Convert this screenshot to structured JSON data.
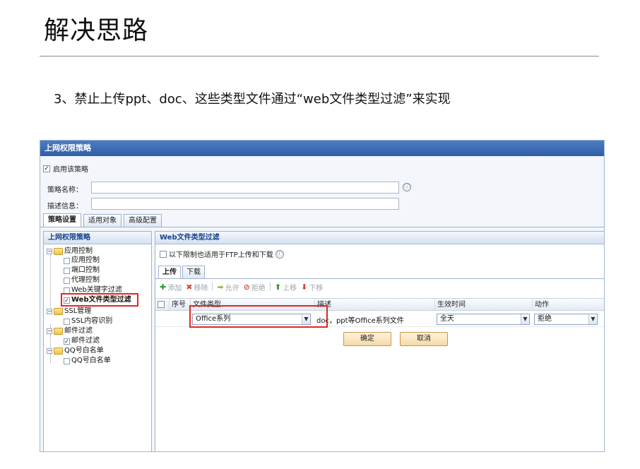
{
  "slide": {
    "title": "解决思路",
    "step": "3、禁止上传ppt、doc、这些类型文件通过“web文件类型过滤”来实现"
  },
  "window": {
    "title": "上网权限策略",
    "enable_label": "启用该策略",
    "name_label": "策略名称：",
    "name_value": "",
    "desc_label": "描述信息：",
    "desc_value": "",
    "info_glyph": "ⓘ"
  },
  "top_tabs": [
    "策略设置",
    "适用对象",
    "高级配置"
  ],
  "left_panel": {
    "title": "上网权限策略",
    "tree": [
      {
        "label": "应用控制",
        "kind": "group"
      },
      {
        "label": "应用控制",
        "kind": "leaf"
      },
      {
        "label": "端口控制",
        "kind": "leaf"
      },
      {
        "label": "代理控制",
        "kind": "leaf"
      },
      {
        "label": "Web关键字过滤",
        "kind": "leaf"
      },
      {
        "label": "Web文件类型过滤",
        "kind": "leaf",
        "checked": true
      },
      {
        "label": "SSL管理",
        "kind": "group"
      },
      {
        "label": "SSL内容识别",
        "kind": "leaf"
      },
      {
        "label": "邮件过滤",
        "kind": "group"
      },
      {
        "label": "邮件过滤",
        "kind": "leaf",
        "checked": true
      },
      {
        "label": "QQ号白名单",
        "kind": "group"
      },
      {
        "label": "QQ号白名单",
        "kind": "leaf"
      }
    ]
  },
  "right_panel": {
    "title": "Web文件类型过滤",
    "ftp_label": "以下限制也适用于FTP上传和下载",
    "sub_tabs": [
      "上传",
      "下载"
    ],
    "toolbar": [
      {
        "label": "添加",
        "icon": "plus-icon",
        "glyph": "✚"
      },
      {
        "label": "移除",
        "icon": "x-icon",
        "glyph": "✖"
      },
      {
        "label": "允许",
        "icon": "arrow-right-icon",
        "glyph": "➡"
      },
      {
        "label": "拒绝",
        "icon": "deny-icon",
        "glyph": "⊘"
      },
      {
        "label": "上移",
        "icon": "arrow-up-icon",
        "glyph": "⬆"
      },
      {
        "label": "下移",
        "icon": "arrow-down-icon",
        "glyph": "⬇"
      }
    ],
    "columns": [
      "序号",
      "文件类型",
      "描述",
      "生效时间",
      "动作"
    ],
    "row": {
      "file_type": "Office系列",
      "description": "doc，ppt等Office系列文件",
      "time": "全天",
      "action": "拒绝"
    },
    "ok_label": "确定",
    "cancel_label": "取消"
  },
  "colors": {
    "titlebar": "#2f5ea7",
    "highlight": "#e32626",
    "panel_header": "#15428b"
  }
}
